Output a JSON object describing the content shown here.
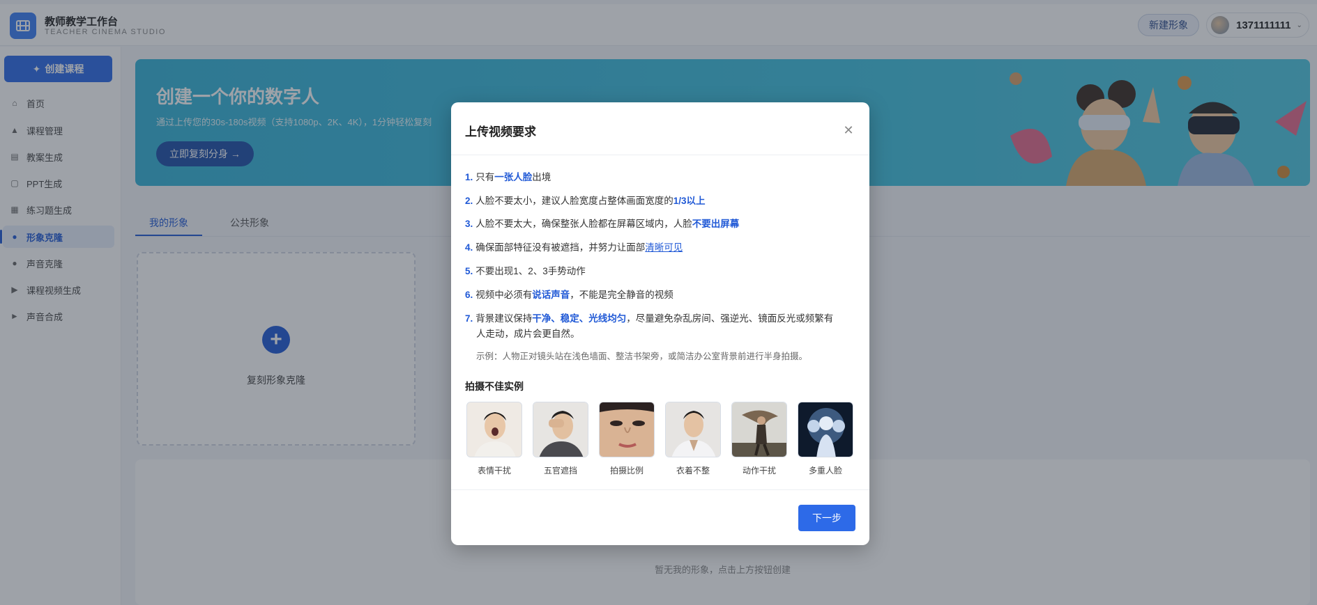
{
  "header": {
    "app_title": "教师教学工作台",
    "app_subtitle": "TEACHER CINEMA STUDIO",
    "new_avatar_label": "新建形象",
    "username": "1371111111"
  },
  "sidebar": {
    "create_label": "创建课程",
    "items": [
      {
        "label": "首页",
        "icon": "home-icon"
      },
      {
        "label": "课程管理",
        "icon": "graduation-cap-icon"
      },
      {
        "label": "教案生成",
        "icon": "document-icon"
      },
      {
        "label": "PPT生成",
        "icon": "file-icon"
      },
      {
        "label": "练习题生成",
        "icon": "book-icon"
      },
      {
        "label": "形象克隆",
        "icon": "user-icon",
        "active": true
      },
      {
        "label": "声音克隆",
        "icon": "microphone-icon"
      },
      {
        "label": "课程视频生成",
        "icon": "play-circle-icon"
      },
      {
        "label": "声音合成",
        "icon": "volume-icon"
      }
    ]
  },
  "banner": {
    "title": "创建一个你的数字人",
    "subtitle": "通过上传您的30s-180s视频（支持1080p、2K、4K），1分钟轻松复刻",
    "button_label": "立即复刻分身 →"
  },
  "tabs": {
    "mine": "我的形象",
    "public": "公共形象"
  },
  "clone_card": {
    "label": "复刻形象克隆"
  },
  "empty_state": "暂无我的形象，点击上方按钮创建",
  "modal": {
    "title": "上传视频要求",
    "requirements": {
      "r1": {
        "n": "1.",
        "a": "只有",
        "b": "一张人脸",
        "c": "出境"
      },
      "r2": {
        "n": "2.",
        "a": "人脸不要太小，建议人脸宽度占整体画面宽度的",
        "b": "1/3以上"
      },
      "r3": {
        "n": "3.",
        "a": "人脸不要太大，确保整张人脸都在屏幕区域内，人脸",
        "b": "不要出屏幕"
      },
      "r4": {
        "n": "4.",
        "a": "确保面部特征没有被遮挡，并努力让面部",
        "b": "清晰可见"
      },
      "r5": {
        "n": "5.",
        "a": "不要出现1、2、3手势动作"
      },
      "r6": {
        "n": "6.",
        "a": "视频中必须有",
        "b": "说话声音",
        "c": "，不能是完全静音的视频"
      },
      "r7": {
        "n": "7.",
        "a": "背景建议保持",
        "b": "干净、稳定、光线均匀",
        "c": "，尽量避免杂乱房间、强逆光、镜面反光或频繁有",
        "d": "人走动，成片会更自然。"
      }
    },
    "example": "示例：人物正对镜头站在浅色墙面、整洁书架旁，或简洁办公室背景前进行半身拍摄。",
    "bad_examples_title": "拍摄不佳实例",
    "bad_examples": [
      {
        "label": "表情干扰"
      },
      {
        "label": "五官遮挡"
      },
      {
        "label": "拍摄比例"
      },
      {
        "label": "衣着不整"
      },
      {
        "label": "动作干扰"
      },
      {
        "label": "多重人脸"
      }
    ],
    "next_label": "下一步"
  },
  "colors": {
    "primary": "#2d6ae8",
    "accent_text": "#2059d6",
    "banner": "#3fc0de"
  }
}
